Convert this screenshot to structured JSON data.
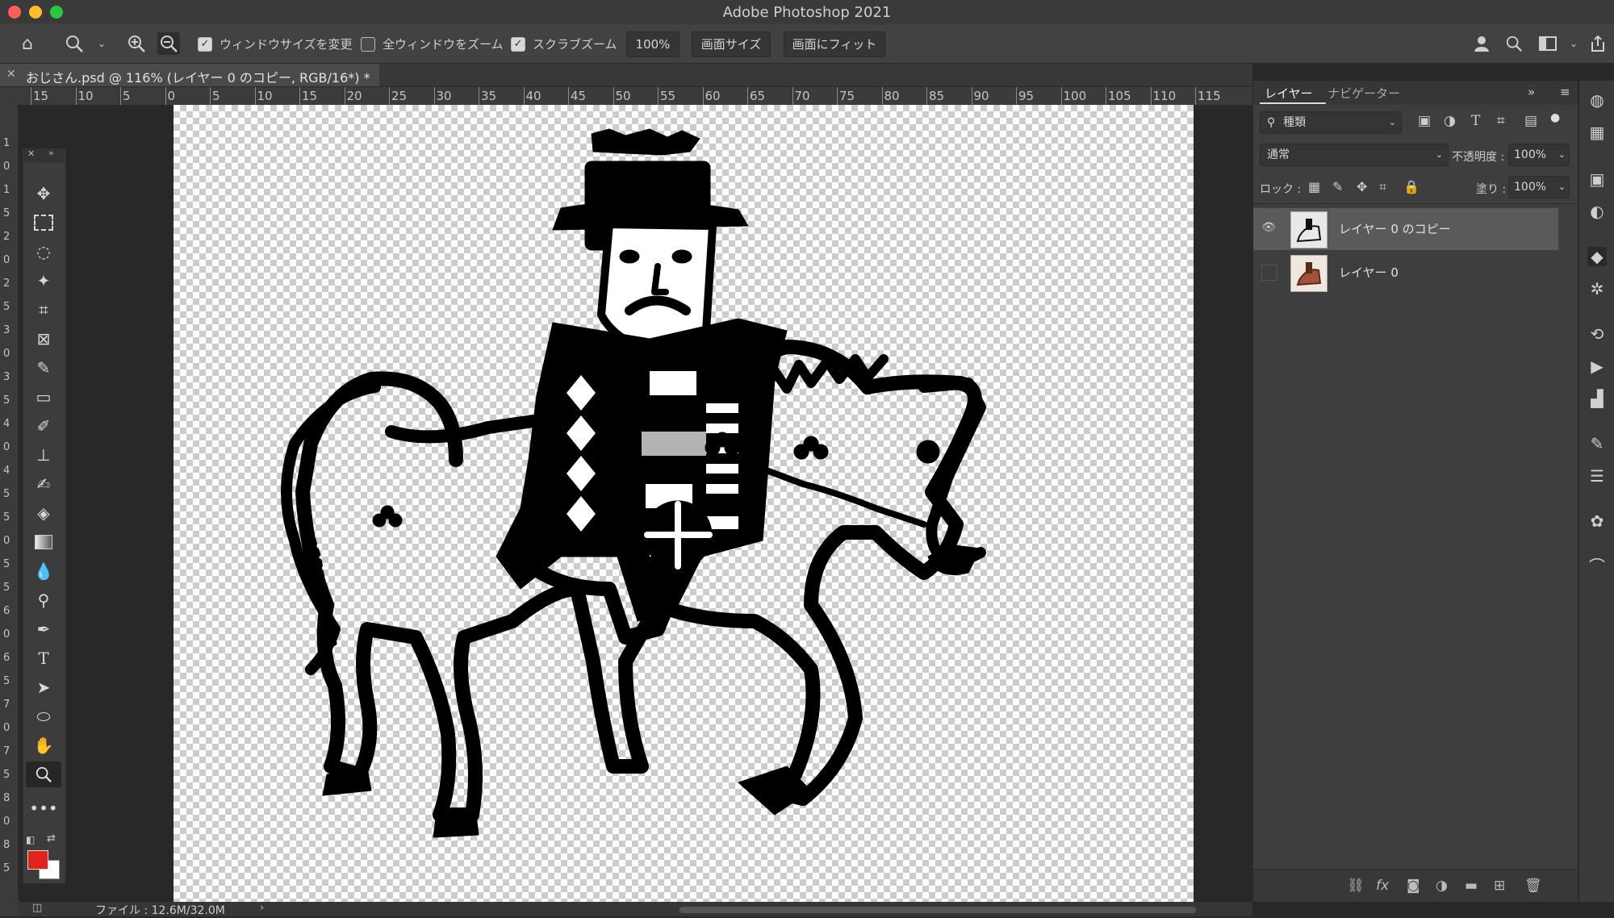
{
  "app": {
    "title": "Adobe Photoshop 2021"
  },
  "options_bar": {
    "resize_windows_label": "ウィンドウサイズを変更",
    "resize_windows_checked": true,
    "zoom_all_label": "全ウィンドウをズーム",
    "zoom_all_checked": false,
    "scrubby_zoom_label": "スクラブズーム",
    "scrubby_zoom_checked": true,
    "zoom_value": "100%",
    "fit_screen_button": "画面サイズ",
    "fill_screen_button": "画面にフィット"
  },
  "document": {
    "tab_label": "おじさん.psd @ 116% (レイヤー 0 のコピー, RGB/16*) *"
  },
  "ruler": {
    "h_ticks": [
      "15",
      "10",
      "5",
      "0",
      "5",
      "10",
      "15",
      "20",
      "25",
      "30",
      "35",
      "40",
      "45",
      "50",
      "55",
      "60",
      "65",
      "70",
      "75",
      "80",
      "85",
      "90",
      "95",
      "100",
      "105",
      "110",
      "115"
    ],
    "v_ticks": [
      "1",
      "0",
      "1",
      "5",
      "2",
      "0",
      "2",
      "5",
      "3",
      "0",
      "3",
      "5",
      "4",
      "0",
      "4",
      "5",
      "5",
      "0",
      "5",
      "5",
      "6",
      "0",
      "6",
      "5",
      "7",
      "0",
      "7",
      "5",
      "8",
      "0",
      "8",
      "5"
    ]
  },
  "toolbar": {
    "tools": [
      "move",
      "marquee",
      "lasso",
      "magic-wand",
      "crop",
      "frame",
      "eyedropper",
      "healing",
      "brush",
      "stamp",
      "history-brush",
      "eraser",
      "gradient",
      "blur",
      "dodge",
      "pen",
      "type",
      "path-select",
      "shape",
      "hand",
      "zoom",
      "more"
    ],
    "selected": "zoom",
    "foreground_color": "#e2231a",
    "background_color": "#ffffff"
  },
  "status": {
    "file_info": "ファイル : 12.6M/32.0M"
  },
  "layers_panel": {
    "tabs": [
      "レイヤー",
      "ナビゲーター"
    ],
    "active_tab": "レイヤー",
    "filter_kind": "種類",
    "blend_mode": "通常",
    "opacity_label": "不透明度 :",
    "opacity_value": "100%",
    "lock_label": "ロック :",
    "fill_label": "塗り :",
    "fill_value": "100%",
    "layers": [
      {
        "name": "レイヤー 0 のコピー",
        "visible": true,
        "selected": true
      },
      {
        "name": "レイヤー 0",
        "visible": false,
        "selected": false
      }
    ]
  }
}
